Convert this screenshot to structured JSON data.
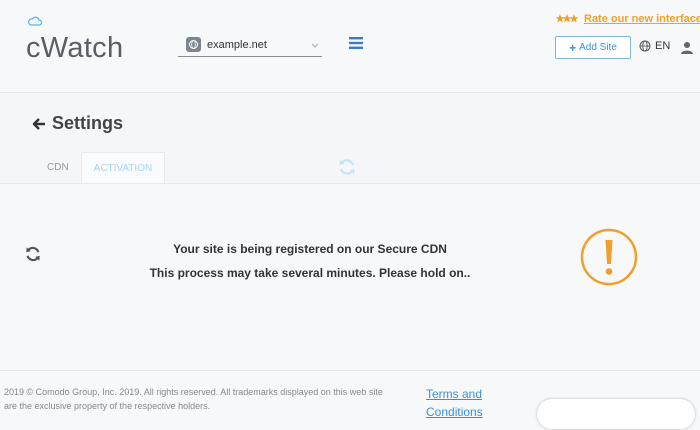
{
  "brand": {
    "name": "cWatch"
  },
  "header": {
    "site_selector": {
      "value": "example.net"
    },
    "rate_link": "Rate our new interface",
    "add_site_label": "Add Site",
    "language": "EN"
  },
  "page": {
    "title": "Settings",
    "tabs": [
      {
        "label": "CDN",
        "active": false
      },
      {
        "label": "ACTIVATION",
        "active": true
      }
    ]
  },
  "status": {
    "line1": "Your site is being registered on our Secure CDN",
    "line2": "This process may take several minutes. Please hold on.."
  },
  "footer": {
    "copyright": "2019 © Comodo Group, Inc. 2019. All rights reserved. All trademarks displayed on this web site are the exclusive property of the respective holders.",
    "terms_line1": "Terms and",
    "terms_line2": "Conditions"
  },
  "colors": {
    "accent": "#3a8fd9",
    "warning": "#f0a02a"
  }
}
